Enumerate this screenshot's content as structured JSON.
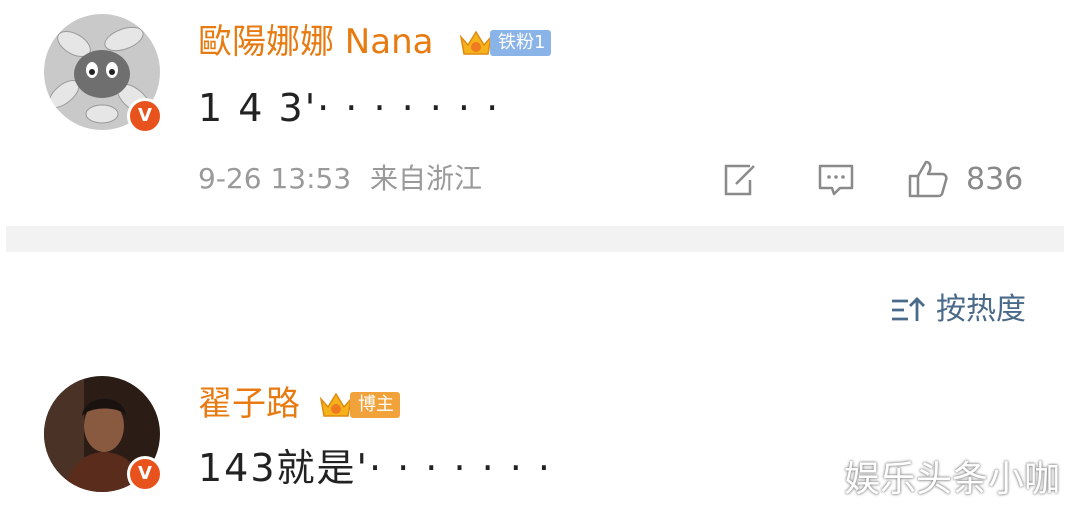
{
  "comments": [
    {
      "username": "歐陽娜娜 Nana",
      "badge_label": "铁粉1",
      "badge_color": "#8ab4e8",
      "verified_mark": "V",
      "text": "1 4 3'· · · · · · ·",
      "date": "9-26 13:53",
      "location": "来自浙江",
      "likes": "836"
    },
    {
      "username": "翟子路",
      "badge_label": "博主",
      "badge_color": "#f2a23a",
      "verified_mark": "V",
      "text": "143就是'· · · · · · ·"
    }
  ],
  "sort": {
    "label": "按热度"
  },
  "watermark": "娱乐头条小咖",
  "colors": {
    "username": "#e77b12",
    "verified": "#e8531d",
    "sort": "#4a6a8a",
    "meta": "#9a9a9a"
  }
}
